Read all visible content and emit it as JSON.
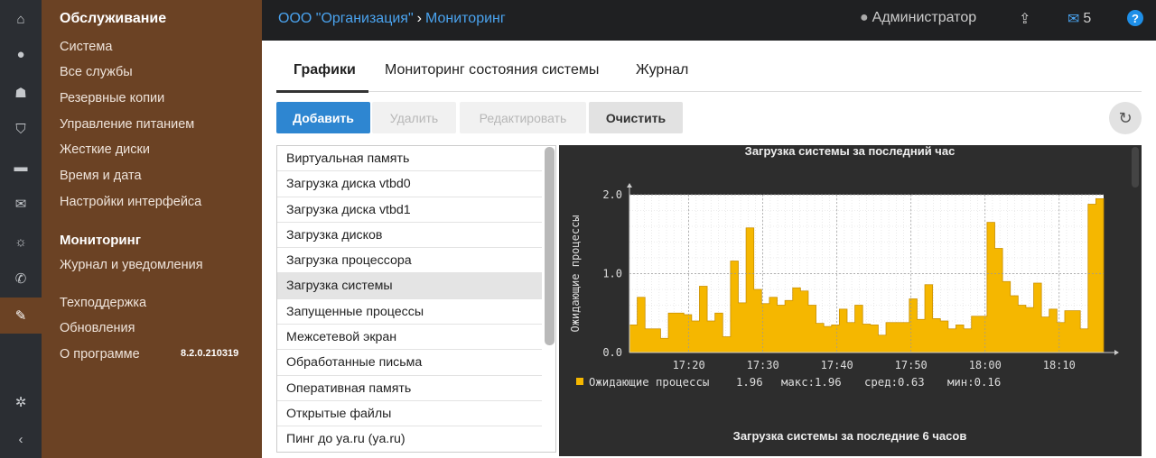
{
  "iconbar": [
    "home-icon",
    "user-icon",
    "sitemap-icon",
    "shield-icon",
    "folder-icon",
    "envelope-icon",
    "lightbulb-icon",
    "phone-icon",
    "wrench-icon",
    "gear-icon",
    "chevron-left-icon"
  ],
  "menu": {
    "service": "Обслуживание",
    "service_items": [
      "Система",
      "Все службы",
      "Резервные копии",
      "Управление питанием",
      "Жесткие диски",
      "Время и дата",
      "Настройки интерфейса"
    ],
    "monitoring": "Мониторинг",
    "monitoring_items": [
      "Журнал и уведомления"
    ],
    "other_items": [
      "Техподдержка",
      "Обновления",
      "О программе"
    ],
    "version": "8.2.0.210319"
  },
  "topbar": {
    "org": "ООО \"Организация\"",
    "section": "Мониторинг",
    "user": "Администратор",
    "mail_count": "5"
  },
  "tabs": [
    "Графики",
    "Мониторинг состояния системы",
    "Журнал"
  ],
  "buttons": {
    "add": "Добавить",
    "delete": "Удалить",
    "edit": "Редактировать",
    "clear": "Очистить"
  },
  "list": [
    "Виртуальная память",
    "Загрузка диска vtbd0",
    "Загрузка диска vtbd1",
    "Загрузка дисков",
    "Загрузка процессора",
    "Загрузка системы",
    "Запущенные процессы",
    "Межсетевой экран",
    "Обработанные письма",
    "Оперативная память",
    "Открытые файлы",
    "Пинг до ya.ru (ya.ru)"
  ],
  "selected_index": 5,
  "chart_data": {
    "type": "area",
    "title": "Загрузка системы за последний час",
    "ylabel": "Ожидающие процессы",
    "ylim": [
      0,
      2.0
    ],
    "yticks": [
      "0.0",
      "1.0",
      "2.0"
    ],
    "xticks": [
      "17:20",
      "17:30",
      "17:40",
      "17:50",
      "18:00",
      "18:10"
    ],
    "x_range": [
      "17:12",
      "18:16"
    ],
    "color": "#f5b700",
    "values": [
      0.35,
      0.7,
      0.3,
      0.3,
      0.18,
      0.5,
      0.5,
      0.48,
      0.4,
      0.84,
      0.4,
      0.5,
      0.2,
      1.16,
      0.63,
      1.58,
      0.8,
      0.62,
      0.7,
      0.6,
      0.66,
      0.82,
      0.78,
      0.6,
      0.37,
      0.33,
      0.35,
      0.55,
      0.38,
      0.6,
      0.36,
      0.35,
      0.22,
      0.38,
      0.38,
      0.38,
      0.68,
      0.42,
      0.86,
      0.43,
      0.4,
      0.3,
      0.35,
      0.3,
      0.46,
      0.46,
      1.65,
      1.32,
      0.9,
      0.72,
      0.6,
      0.57,
      0.88,
      0.45,
      0.55,
      0.38,
      0.53,
      0.53,
      0.3,
      1.88,
      1.95
    ],
    "legend": {
      "name": "Ожидающие процессы",
      "current": "1.96",
      "max": "макс:1.96",
      "avg": "сред:0.63",
      "min": "мин:0.16"
    },
    "next_title": "Загрузка системы за последние 6 часов"
  }
}
